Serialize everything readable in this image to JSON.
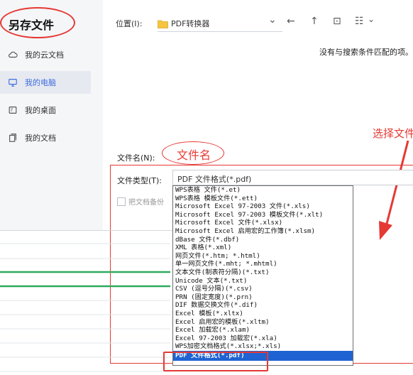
{
  "dialog": {
    "title": "另存文件"
  },
  "sidebar": {
    "items": [
      {
        "label": "我的云文档",
        "icon": "cloud-icon",
        "active": false
      },
      {
        "label": "我的电脑",
        "icon": "monitor-icon",
        "active": true
      },
      {
        "label": "我的桌面",
        "icon": "desktop-icon",
        "active": false
      },
      {
        "label": "我的文档",
        "icon": "documents-icon",
        "active": false
      }
    ]
  },
  "toolbar": {
    "location_label": "位置(I):",
    "location_value": "PDF转换器",
    "dropdown_glyph": "⌄",
    "back_glyph": "←",
    "up_glyph": "↑",
    "new_folder_glyph": "⊡",
    "view_glyph": "☷",
    "view_chevron": "⌄"
  },
  "file_list": {
    "empty_message": "没有与搜索条件匹配的项。"
  },
  "filename": {
    "label": "文件名(N):",
    "annotation": "文件名"
  },
  "filetype": {
    "label": "文件类型(T):",
    "selected": "PDF 文件格式(*.pdf)",
    "options": [
      "WPS表格 文件(*.et)",
      "WPS表格 模板文件(*.ett)",
      "Microsoft Excel 97-2003 文件(*.xls)",
      "Microsoft Excel 97-2003 模板文件(*.xlt)",
      "Microsoft Excel 文件(*.xlsx)",
      "Microsoft Excel 启用宏的工作簿(*.xlsm)",
      "dBase 文件(*.dbf)",
      "XML 表格(*.xml)",
      "网页文件(*.htm; *.html)",
      "单一网页文件(*.mht; *.mhtml)",
      "文本文件(制表符分隔)(*.txt)",
      "Unicode 文本(*.txt)",
      "CSV (逗号分隔)(*.csv)",
      "PRN (固定宽度)(*.prn)",
      "DIF 数据交换文件(*.dif)",
      "Excel 模板(*.xltx)",
      "Excel 启用宏的模板(*.xltm)",
      "Excel 加载宏(*.xlam)",
      "Excel 97-2003 加载宏(*.xla)",
      "WPS加密文档格式(*.xlsx;*.xls)",
      "PDF 文件格式(*.pdf)"
    ],
    "selected_index": 20
  },
  "backup": {
    "label": "把文档备份"
  },
  "annotation": {
    "select_text": "选择文件"
  },
  "colors": {
    "accent": "#3d6ee0",
    "highlight": "#1f63d2",
    "annotation_red": "#e53935",
    "sheet_green": "#2eaa5e"
  }
}
